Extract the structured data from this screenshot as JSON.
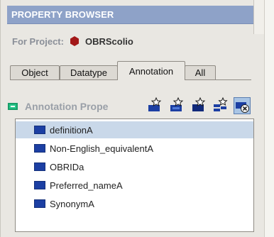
{
  "panel": {
    "title": "PROPERTY BROWSER",
    "project_label": "For Project:",
    "project_name": "OBRScolio"
  },
  "tabs": [
    {
      "label": "Object",
      "active": false
    },
    {
      "label": "Datatype",
      "active": false
    },
    {
      "label": "Annotation",
      "active": true
    },
    {
      "label": "All",
      "active": false
    }
  ],
  "toolbar": {
    "label": "Annotation Prope",
    "buttons": [
      {
        "icon": "create-property-icon"
      },
      {
        "icon": "create-subproperty-icon"
      },
      {
        "icon": "create-property-dark-icon"
      },
      {
        "icon": "create-multiple-icon"
      },
      {
        "icon": "delete-property-icon"
      }
    ]
  },
  "properties": [
    {
      "label": "definitionA",
      "selected": true
    },
    {
      "label": "Non-English_equivalentA",
      "selected": false
    },
    {
      "label": "OBRIDa",
      "selected": false
    },
    {
      "label": "Preferred_nameA",
      "selected": false
    },
    {
      "label": "SynonymA",
      "selected": false
    }
  ],
  "colors": {
    "title_bar": "#8ea2c8",
    "project_icon": "#a31818",
    "property_icon": "#1c3fa3",
    "annotation_icon": "#26c78a",
    "selection": "#c9d8e9"
  }
}
